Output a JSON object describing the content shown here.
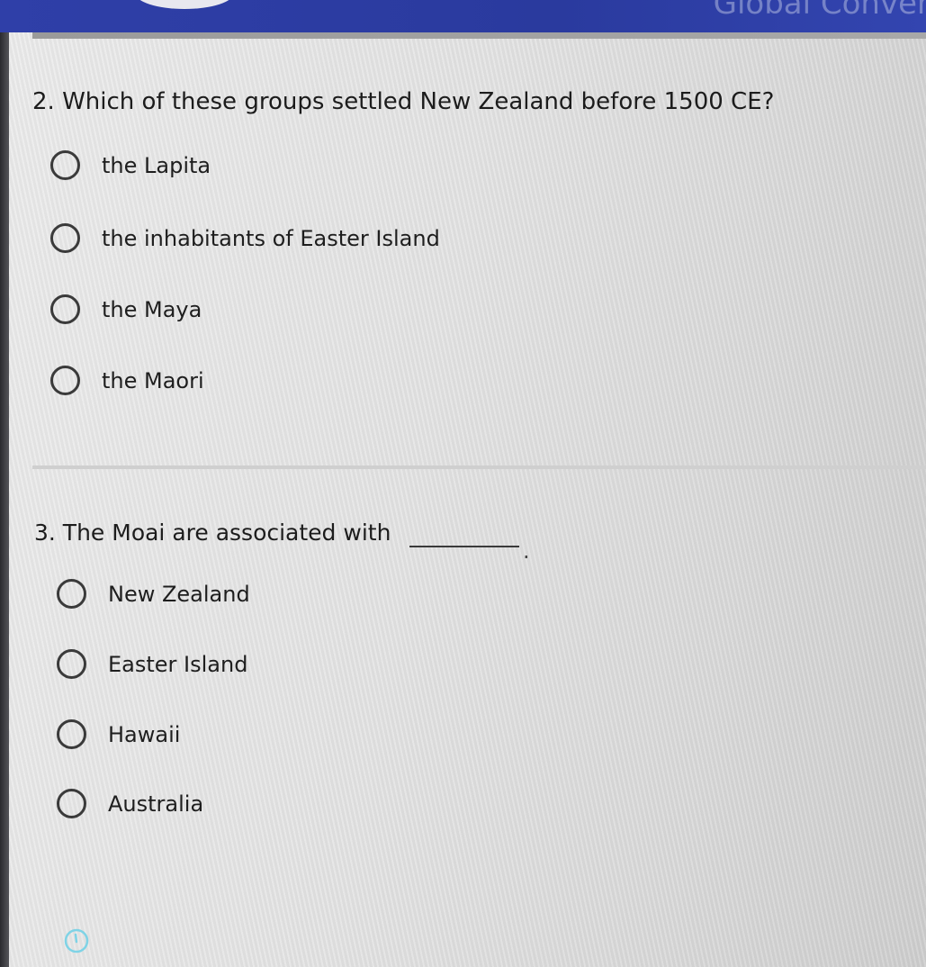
{
  "header": {
    "partial_title": "Global Conver"
  },
  "questions": [
    {
      "prompt": "2. Which of these groups settled New Zealand before 1500 CE?",
      "options": [
        "the Lapita",
        "the inhabitants of Easter Island",
        "the Maya",
        "the Maori"
      ]
    },
    {
      "prompt": "3. The Moai are associated with",
      "blank_suffix": ".",
      "options": [
        "New Zealand",
        "Easter Island",
        "Hawaii",
        "Australia"
      ]
    }
  ],
  "icons": {
    "timer": "clock-icon"
  },
  "colors": {
    "header_bar": "#2f3fa8",
    "timer_icon": "#7fd3e6"
  }
}
